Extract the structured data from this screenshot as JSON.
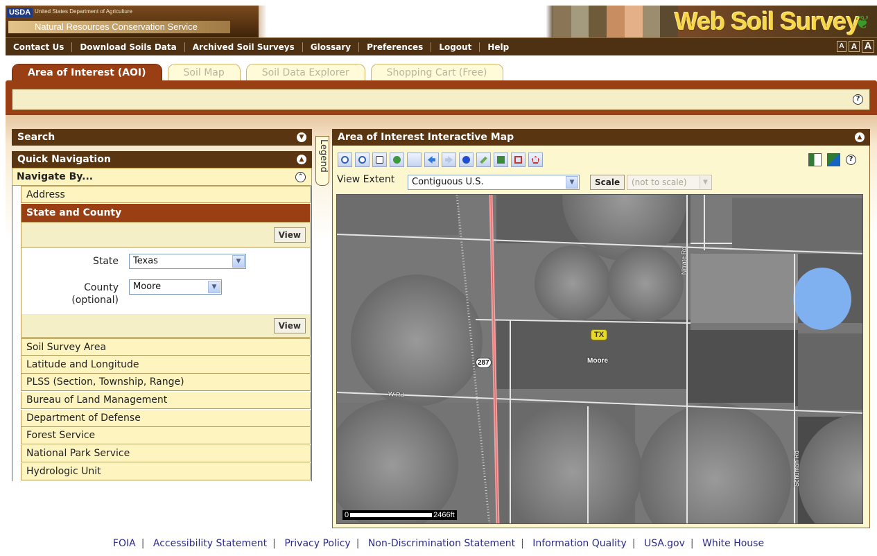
{
  "banner": {
    "usda_logo": "USDA",
    "department": "United States Department of Agriculture",
    "agency": "Natural Resources Conservation Service",
    "app_title": "Web Soil Survey"
  },
  "topnav": {
    "links": [
      "Contact Us",
      "Download Soils Data",
      "Archived Soil Surveys",
      "Glossary",
      "Preferences",
      "Logout",
      "Help"
    ],
    "text_size": [
      "A",
      "A",
      "A"
    ]
  },
  "tabs": [
    {
      "label": "Area of Interest (AOI)",
      "active": true
    },
    {
      "label": "Soil Map",
      "active": false
    },
    {
      "label": "Soil Data Explorer",
      "active": false
    },
    {
      "label": "Shopping Cart (Free)",
      "active": false
    }
  ],
  "help_icon": "?",
  "left": {
    "search_title": "Search",
    "quick_nav_title": "Quick Navigation",
    "navigate_by": "Navigate By...",
    "items_top": [
      "Address",
      "State and County"
    ],
    "view_label": "View",
    "state_label": "State",
    "state_value": "Texas",
    "county_label": "County",
    "county_optional": "(optional)",
    "county_value": "Moore",
    "items_bottom": [
      "Soil Survey Area",
      "Latitude and Longitude",
      "PLSS (Section, Township, Range)",
      "Bureau of Land Management",
      "Department of Defense",
      "Forest Service",
      "National Park Service",
      "Hydrologic Unit"
    ]
  },
  "legend_label": "Legend",
  "map_panel": {
    "title": "Area of Interest Interactive Map",
    "view_extent_label": "View Extent",
    "view_extent_value": "Contiguous U.S.",
    "scale_button": "Scale",
    "scale_value": "(not to scale)",
    "toolbar": [
      "zoom-in-icon",
      "zoom-out-icon",
      "pan-hand-icon",
      "globe-icon",
      "blank-tool-icon",
      "back-arrow-icon",
      "forward-arrow-icon",
      "identify-info-icon",
      "measure-ruler-icon",
      "clear-layers-icon",
      "define-aoi-rectangle-icon",
      "define-aoi-polygon-icon"
    ],
    "map_labels": {
      "road_287": "287",
      "state_badge": "TX",
      "town": "Moore",
      "road_w": "W Rd",
      "road_nitrate": "Nitrate Rd",
      "road_schuman": "Schuman Rd",
      "scale_start": "0",
      "scale_end": "2466ft"
    },
    "colors": {
      "water": "#7fb0f0",
      "highway": "#f0a0a0",
      "header": "#5a3512",
      "accent": "#9a3e14"
    }
  },
  "footer": {
    "links": [
      "FOIA",
      "Accessibility Statement",
      "Privacy Policy",
      "Non-Discrimination Statement",
      "Information Quality",
      "USA.gov",
      "White House"
    ]
  }
}
